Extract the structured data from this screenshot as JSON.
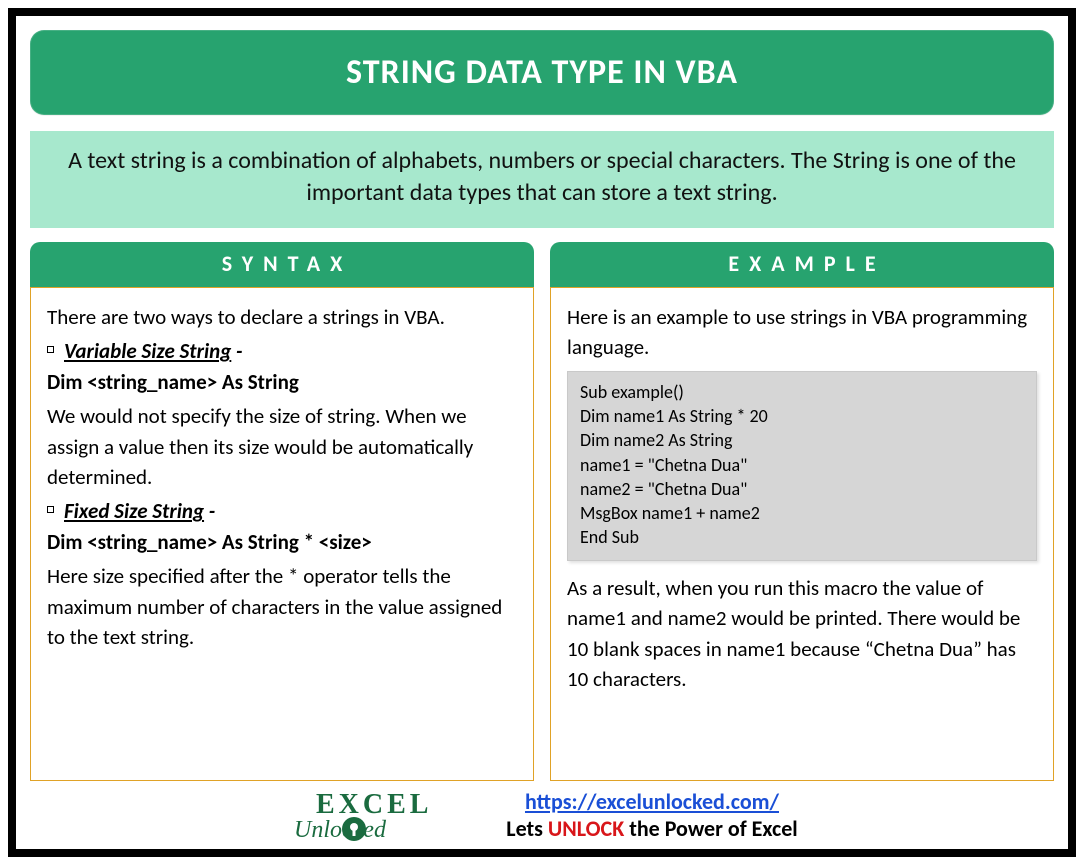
{
  "title": "STRING DATA TYPE IN VBA",
  "intro": "A text string is a combination of alphabets, numbers or special characters. The String is one of the important data types that can store a text string.",
  "syntax": {
    "tab": "SYNTAX",
    "lead": "There are two ways to declare a strings in VBA.",
    "item1_title": "Variable Size String",
    "item1_dash": " -",
    "item1_decl": "Dim <string_name> As String",
    "item1_desc": "We would not specify the size of string. When we assign a value then its size would be automatically determined.",
    "item2_title": "Fixed Size String",
    "item2_dash": " -",
    "item2_decl": "Dim <string_name> As String * <size>",
    "item2_desc": "Here size specified after the * operator tells the maximum number of characters in the value assigned to the text string."
  },
  "example": {
    "tab": "EXAMPLE",
    "lead": "Here is an example to use strings in VBA programming language.",
    "code": "Sub example()\nDim name1 As String * 20\nDim name2 As String\nname1 = \"Chetna Dua\"\nname2 = \"Chetna Dua\"\nMsgBox name1 + name2\nEnd Sub",
    "result": "As a result, when you run this macro the value of name1 and name2 would be printed. There would be 10 blank spaces in name1 because “Chetna Dua” has 10 characters."
  },
  "footer": {
    "url": "https://excelunlocked.com/",
    "tag_pre": "Lets ",
    "tag_unlock": "UNLOCK",
    "tag_post": " the Power of Excel",
    "logo_top": "EXCEL",
    "logo_bottom": "Unlocked"
  }
}
